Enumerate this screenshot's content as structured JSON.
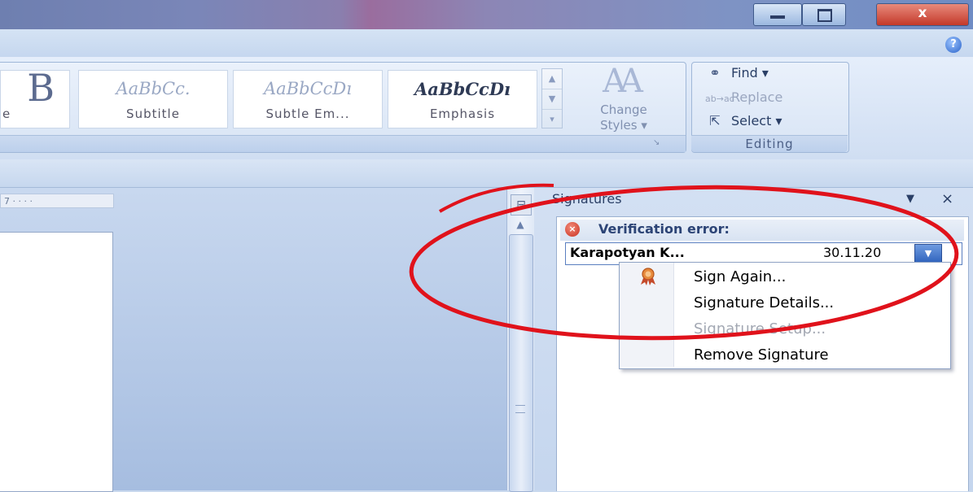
{
  "window": {
    "close_glyph": "x",
    "help_glyph": "?"
  },
  "ribbon": {
    "styles": {
      "big_sample": "B",
      "big_name": "e",
      "tiles": [
        {
          "sample": "AaBbCc.",
          "name": "Subtitle"
        },
        {
          "sample": "AaBbCcDı",
          "name": "Subtle Em..."
        },
        {
          "sample": "AaBbCcDı",
          "name": "Emphasis"
        }
      ],
      "change_styles_line1": "Change",
      "change_styles_line2": "Styles ▾",
      "change_styles_art": "AA"
    },
    "editing": {
      "find": "Find ▾",
      "replace": "Replace",
      "select": "Select ▾",
      "group_label": "Editing",
      "replace_icon": "ab→ac"
    }
  },
  "ruler_text": "7 · · · ·",
  "signatures": {
    "title": "Signatures",
    "dropdown_glyph": "▼",
    "close_glyph": "×",
    "error_glyph": "×",
    "verification_error": "Verification error:",
    "entry_name": "Karapotyan K...",
    "entry_date": "30.11.20",
    "entry_button_glyph": "▼"
  },
  "context_menu": {
    "sign_again": "Sign Again...",
    "details": "Signature Details...",
    "setup": "Signature Setup...",
    "remove": "Remove Signature"
  },
  "colors": {
    "annotation": "#e0121b",
    "ribbon_text": "#2a3f66",
    "menu_disabled": "#a3a8b3"
  }
}
